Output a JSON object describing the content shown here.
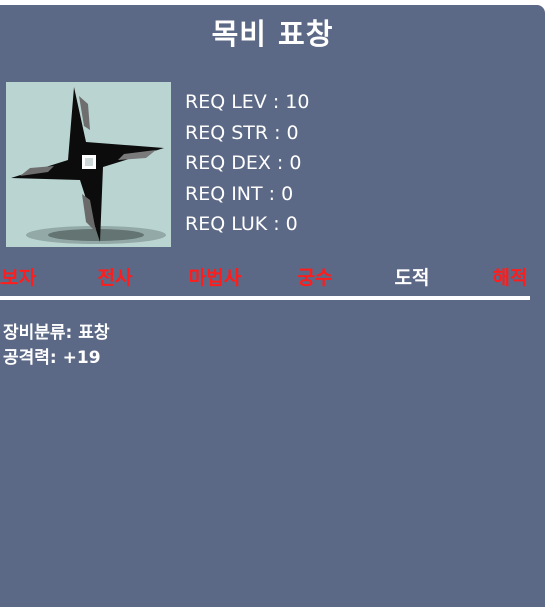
{
  "item": {
    "name": "목비 표창",
    "icon": "throwing-star-icon"
  },
  "requirements": [
    {
      "label": "REQ LEV : 10"
    },
    {
      "label": "REQ STR : 0"
    },
    {
      "label": "REQ DEX : 0"
    },
    {
      "label": "REQ INT : 0"
    },
    {
      "label": "REQ LUK : 0"
    }
  ],
  "jobs": [
    {
      "name": "초보자",
      "color": "#ff1c1c"
    },
    {
      "name": "전사",
      "color": "#ff1c1c"
    },
    {
      "name": "마법사",
      "color": "#ff1c1c"
    },
    {
      "name": "궁수",
      "color": "#ff1c1c"
    },
    {
      "name": "도적",
      "color": "#ffffff"
    },
    {
      "name": "해적",
      "color": "#ff1c1c"
    }
  ],
  "stats": [
    {
      "text": "장비분류: 표창"
    },
    {
      "text": "공격력: +19"
    }
  ],
  "colors": {
    "panel_bg": "#5c6986",
    "restricted_job": "#ff1c1c",
    "allowed_job": "#ffffff"
  }
}
